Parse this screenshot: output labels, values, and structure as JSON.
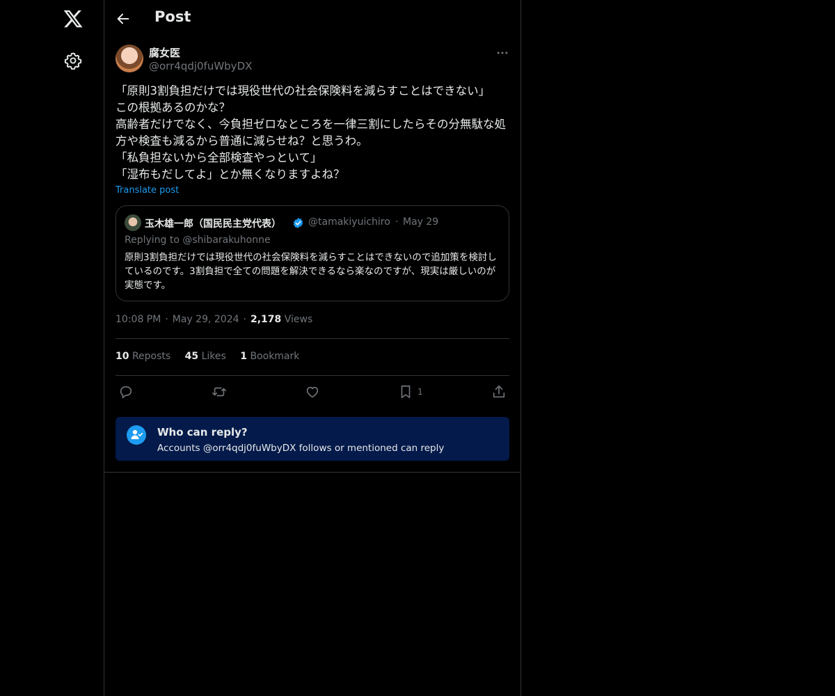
{
  "header": {
    "title": "Post"
  },
  "post": {
    "author_name": "腐女医",
    "author_handle": "@orr4qdj0fuWbyDX",
    "text": "「原則3割負担だけでは現役世代の社会保険料を減らすことはできない」\nこの根拠あるのかな？\n高齢者だけでなく、今負担ゼロなところを一律三割にしたらその分無駄な処方や検査も減るから普通に減らせね？と思うわ。\n「私負担ないから全部検査やっといて」\n「湿布もだしてよ」とか無くなりますよね？",
    "translate_label": "Translate post"
  },
  "quote": {
    "author_name": "玉木雄一郎（国民民主党代表）",
    "author_handle": "@tamakiyuichiro",
    "separator": "·",
    "date": "May 29",
    "replying_to": "Replying to @shibarakuhonne",
    "text": "原則3割負担だけでは現役世代の社会保険料を減らすことはできないので追加策を検討しているのです。3割負担で全ての問題を解決できるなら楽なのですが、現実は厳しいのが実態です。"
  },
  "meta": {
    "time": "10:08 PM",
    "separator": "·",
    "date": "May 29, 2024",
    "views_count": "2,178",
    "views_label": "Views"
  },
  "stats": {
    "reposts_count": "10",
    "reposts_label": "Reposts",
    "likes_count": "45",
    "likes_label": "Likes",
    "bookmarks_count": "1",
    "bookmarks_label": "Bookmark"
  },
  "actions": {
    "bookmark_count": "1"
  },
  "who_can_reply": {
    "title": "Who can reply?",
    "description": "Accounts @orr4qdj0fuWbyDX follows or mentioned can reply"
  },
  "icons": [
    "x-logo-icon",
    "gear-icon",
    "back-arrow-icon",
    "more-icon",
    "verified-icon",
    "reply-icon",
    "repost-icon",
    "like-icon",
    "bookmark-icon",
    "share-icon",
    "person-check-icon"
  ],
  "colors": {
    "background": "#000000",
    "accent": "#1d9bf0",
    "muted": "#71767b",
    "notice_bg": "#031a4a"
  }
}
